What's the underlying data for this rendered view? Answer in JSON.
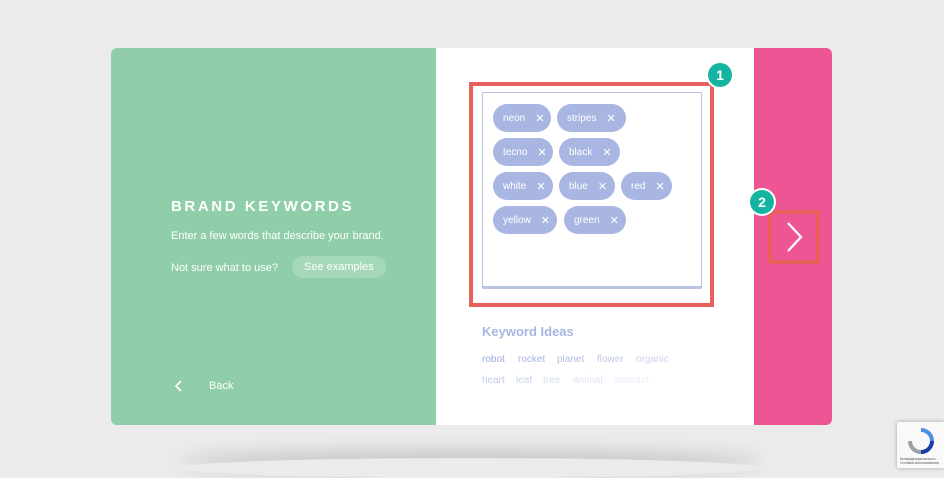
{
  "brand": {
    "title": "BRAND KEYWORDS",
    "subtitle": "Enter a few words that describe your brand.",
    "hint": "Not sure what to use?",
    "examples_button": "See examples",
    "back_label": "Back"
  },
  "keywords": [
    "neon",
    "stripes",
    "tecno",
    "black",
    "white",
    "blue",
    "red",
    "yellow",
    "green"
  ],
  "remove_glyph": "✕",
  "badges": [
    "1",
    "2"
  ],
  "ideas": {
    "title": "Keyword Ideas",
    "items": [
      "robot",
      "rocket",
      "planet",
      "flower",
      "organic",
      "heart",
      "leaf",
      "tree",
      "animal",
      "abstract"
    ]
  },
  "recaptcha": {
    "text": "Конфиденциальность · Условия использования"
  },
  "colors": {
    "green": "#8fcea8",
    "pink": "#ee5595",
    "tag": "#a9b6e2",
    "highlight": "#e8605b",
    "badge": "#14b4a0"
  }
}
